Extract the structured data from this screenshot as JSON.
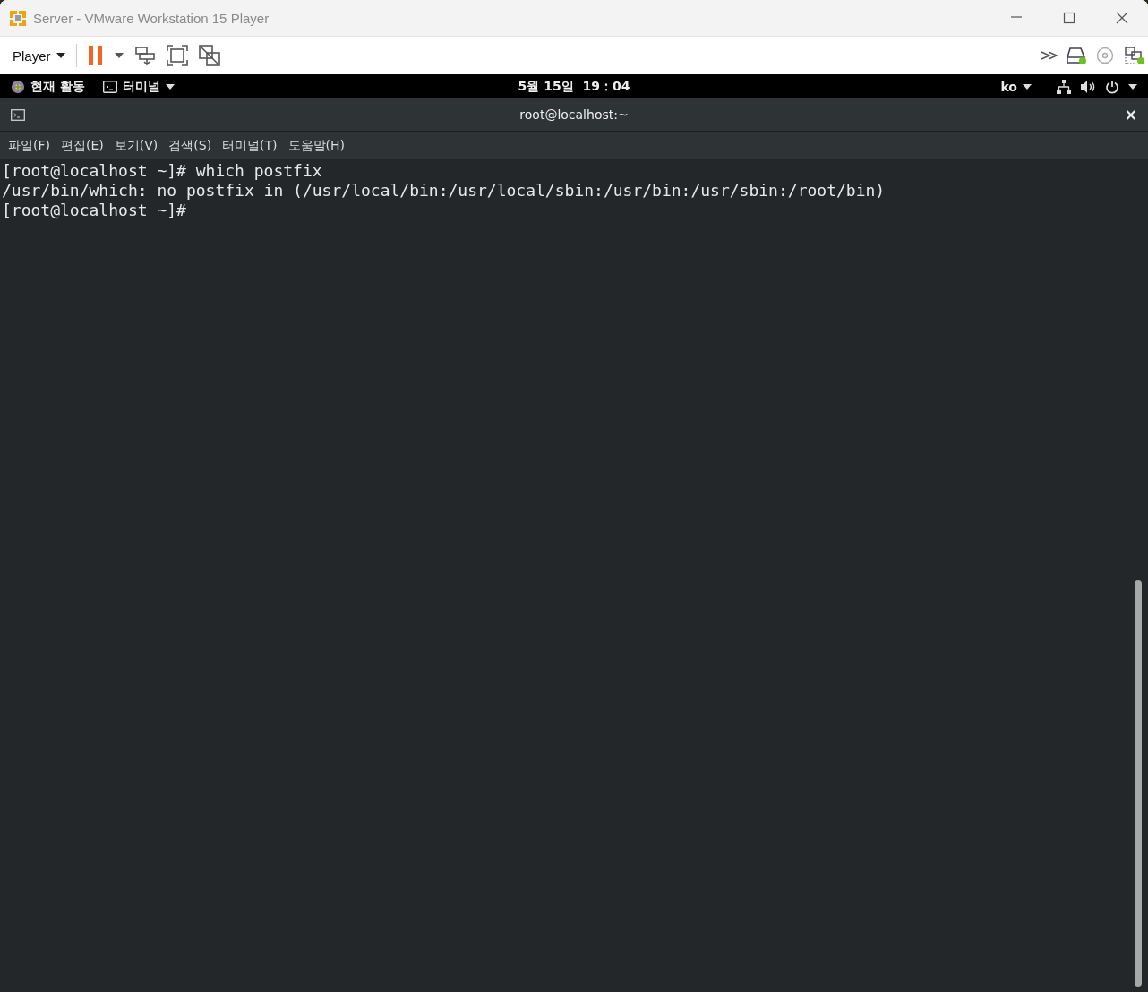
{
  "window": {
    "title": "Server - VMware Workstation 15 Player"
  },
  "toolbar": {
    "player_menu": "Player"
  },
  "gnome_bar": {
    "activities": "현재 활동",
    "app_menu": "터미널",
    "clock": "5월 15일  19：04",
    "input_method": "ko"
  },
  "terminal": {
    "title": "root@localhost:~",
    "close": "×",
    "menu": [
      "파일(F)",
      "편집(E)",
      "보기(V)",
      "검색(S)",
      "터미널(T)",
      "도움말(H)"
    ],
    "lines": [
      "[root@localhost ~]# which postfix",
      "/usr/bin/which: no postfix in (/usr/local/bin:/usr/local/sbin:/usr/bin:/usr/sbin:/root/bin)",
      "[root@localhost ~]#"
    ]
  }
}
